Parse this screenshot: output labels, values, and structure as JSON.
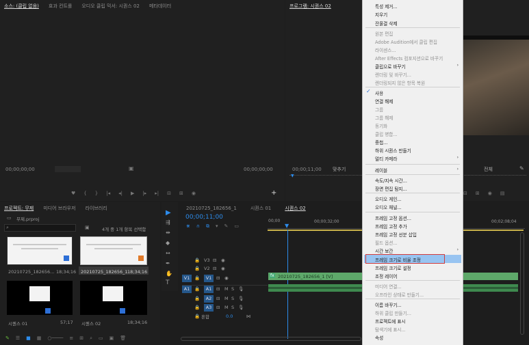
{
  "source_panel": {
    "tabs": [
      "소스: (클립 없음)",
      "효과 컨트롤",
      "오디오 클립 믹서: 시퀀스 02",
      "메타데이터"
    ],
    "timecode_left": "00;00;00;00",
    "timecode_right": "00;00;00;00"
  },
  "program_panel": {
    "tab": "프로그램: 시퀀스 02",
    "timecode": "00;00;11;00",
    "fit_label": "맞추기",
    "quality_label": "전체"
  },
  "project_panel": {
    "tabs": [
      "프로젝트: 무제",
      "미디어 브라우저",
      "라이브러리"
    ],
    "project_file": "무제.prproj",
    "item_count": "4개 중 1개 항목 선택함",
    "items": [
      {
        "name": "20210725_182656...",
        "duration": "18;34;16"
      },
      {
        "name": "20210725_182656_1",
        "duration": "18;34;16"
      },
      {
        "name": "시퀀스 01",
        "duration": "57;17"
      },
      {
        "name": "시퀀스 02",
        "duration": "18;34;16"
      }
    ]
  },
  "timeline": {
    "tabs": [
      "20210725_182656_1",
      "시퀀스 01",
      "시퀀스 02"
    ],
    "timecode": "00;00;11;00",
    "ruler": [
      "00;00",
      "00;00;32;00",
      "00;02;08;04"
    ],
    "tracks": [
      {
        "label": "V3",
        "chip": ""
      },
      {
        "label": "V2",
        "chip": ""
      },
      {
        "label": "V1",
        "chip": "V1"
      },
      {
        "label": "A1",
        "chip": "A1"
      },
      {
        "label": "A2",
        "chip": ""
      },
      {
        "label": "A3",
        "chip": ""
      }
    ],
    "mix_label": "혼합",
    "mix_value": "0.0",
    "clip_name": "20210725_182656_1 [V]"
  },
  "context_menu": {
    "items": [
      {
        "label": "특성 제거...",
        "disabled": false
      },
      {
        "label": "지우기",
        "disabled": false
      },
      {
        "label": "잔물결 삭제",
        "disabled": false
      },
      {
        "label": "원본 편집",
        "disabled": true
      },
      {
        "label": "Adobe Audition에서 클립 편집",
        "disabled": true
      },
      {
        "label": "라이센스...",
        "disabled": true
      },
      {
        "label": "After Effects 컴포지션으로 바꾸기",
        "disabled": true
      },
      {
        "label": "클립으로 바꾸기",
        "disabled": false,
        "submenu": true
      },
      {
        "label": "렌더링 및 바꾸기...",
        "disabled": true
      },
      {
        "label": "렌더링되지 않은 항목 복원",
        "disabled": true
      },
      {
        "label": "사용",
        "disabled": false,
        "checked": true
      },
      {
        "label": "연결 해제",
        "disabled": false
      },
      {
        "label": "그룹",
        "disabled": true
      },
      {
        "label": "그룹 해제",
        "disabled": true
      },
      {
        "label": "동기화",
        "disabled": true
      },
      {
        "label": "클립 병합...",
        "disabled": true
      },
      {
        "label": "중첩...",
        "disabled": false
      },
      {
        "label": "하위 시퀀스 만들기",
        "disabled": false
      },
      {
        "label": "멀티 카메라",
        "disabled": false,
        "submenu": true
      },
      {
        "label": "레이블",
        "disabled": false,
        "submenu": true
      },
      {
        "label": "속도/지속 시간...",
        "disabled": false
      },
      {
        "label": "장면 편집 탐지...",
        "disabled": false
      },
      {
        "label": "오디오 게인...",
        "disabled": false
      },
      {
        "label": "오디오 채널...",
        "disabled": false
      },
      {
        "label": "프레임 고정 옵션...",
        "disabled": false
      },
      {
        "label": "프레임 고정 추가",
        "disabled": false
      },
      {
        "label": "프레임 고정 선분 삽입",
        "disabled": false
      },
      {
        "label": "필드 옵션...",
        "disabled": true
      },
      {
        "label": "시간 보간",
        "disabled": false,
        "submenu": true
      },
      {
        "label": "프레임 크기로 비율 조정",
        "disabled": false,
        "highlighted": true
      },
      {
        "label": "프레임 크기로 설정",
        "disabled": false
      },
      {
        "label": "조정 레이어",
        "disabled": false
      },
      {
        "label": "미디어 연결...",
        "disabled": true
      },
      {
        "label": "오프라인 상태로 만들기...",
        "disabled": true
      },
      {
        "label": "이름 바꾸기...",
        "disabled": false
      },
      {
        "label": "하위 클립 만들기...",
        "disabled": true
      },
      {
        "label": "프로젝트에 표시",
        "disabled": false
      },
      {
        "label": "탐색기에 표시...",
        "disabled": true
      },
      {
        "label": "속성",
        "disabled": false
      }
    ]
  },
  "colors": {
    "accent": "#2d8ceb",
    "menu_highlight": "#98c4f1",
    "red_box": "#d23c3c",
    "clip_video": "#5ea86a"
  }
}
